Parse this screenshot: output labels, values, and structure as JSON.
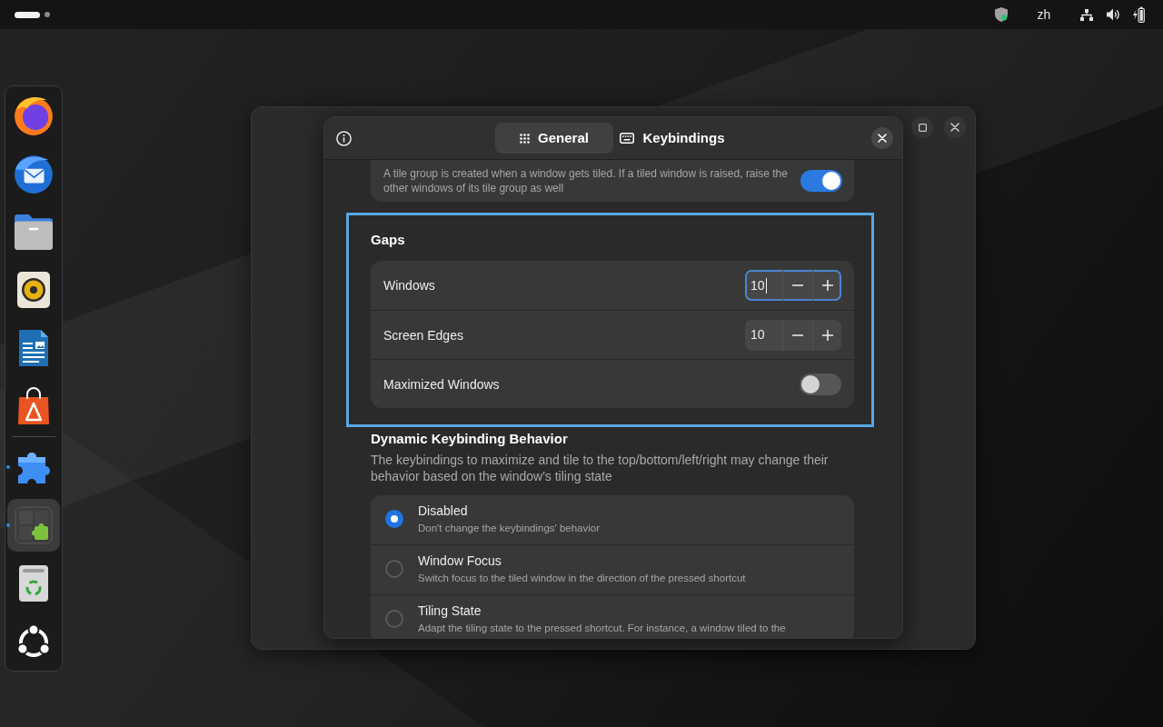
{
  "top_bar": {
    "workspaces": [
      {
        "selected": true
      },
      {
        "selected": false
      }
    ],
    "input_source": "zh"
  },
  "dock": {
    "groups": [
      [
        {
          "kind": "browser",
          "running": false,
          "focused": false
        },
        {
          "kind": "mail",
          "running": false,
          "focused": false
        },
        {
          "kind": "files",
          "running": false,
          "focused": false
        },
        {
          "kind": "music",
          "running": false,
          "focused": false
        },
        {
          "kind": "writer",
          "running": false,
          "focused": false
        },
        {
          "kind": "store",
          "running": false,
          "focused": false
        }
      ],
      [
        {
          "kind": "extensions",
          "running": true,
          "focused": false
        },
        {
          "kind": "extension-manager",
          "running": true,
          "focused": true
        },
        {
          "kind": "trash",
          "running": false,
          "focused": false
        },
        {
          "kind": "apps",
          "running": false,
          "focused": false
        }
      ]
    ]
  },
  "dialog": {
    "tabs": [
      {
        "kind": "grid",
        "label": "General",
        "selected": true
      },
      {
        "kind": "keyboard",
        "label": "Keybindings",
        "selected": false
      }
    ],
    "sections": [
      {
        "rows": [
          {
            "kind": "switch",
            "subtitle": "A tile group is created when a window gets tiled. If a tiled window is raised, raise the other windows of its tile group as well",
            "on": true
          }
        ]
      },
      {
        "title": "Gaps",
        "highlighted": true,
        "rows": [
          {
            "kind": "spin",
            "label": "Windows",
            "value": "10",
            "focused": true
          },
          {
            "kind": "spin",
            "label": "Screen Edges",
            "value": "10",
            "focused": false
          },
          {
            "kind": "switch",
            "label": "Maximized Windows",
            "on": false
          }
        ]
      },
      {
        "title": "Dynamic Keybinding Behavior",
        "description": "The keybindings to maximize and tile to the top/bottom/left/right may change their behavior based on the window's tiling state",
        "rows": [
          {
            "kind": "radio",
            "label": "Disabled",
            "subtitle": "Don't change the keybindings' behavior",
            "selected": true
          },
          {
            "kind": "radio",
            "label": "Window Focus",
            "subtitle": "Switch focus to the tiled window in the direction of the pressed shortcut",
            "selected": false
          },
          {
            "kind": "radio",
            "label": "Tiling State",
            "subtitle": "Adapt the tiling state to the pressed shortcut. For instance, a window tiled to the",
            "selected": false
          }
        ]
      }
    ]
  }
}
